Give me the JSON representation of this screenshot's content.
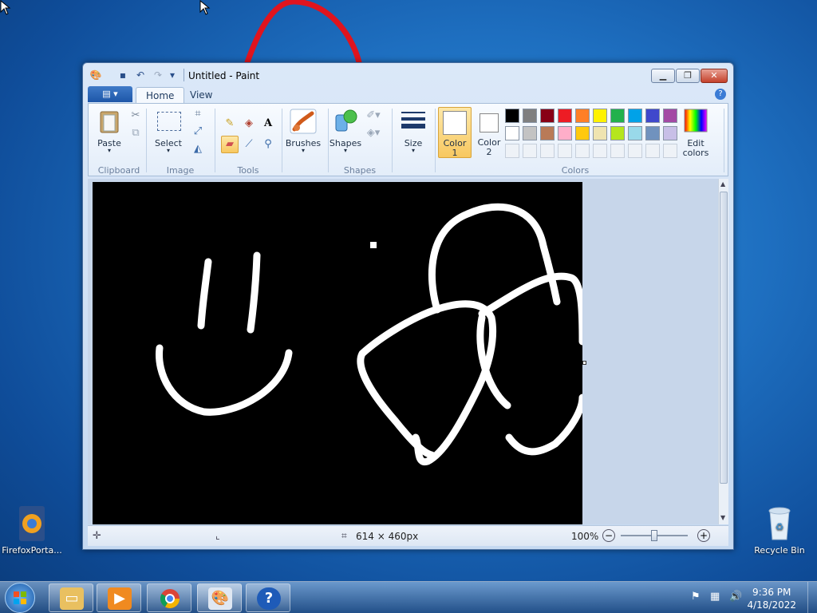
{
  "desktop": {
    "icons": [
      {
        "label": "FirefoxPorta..."
      },
      {
        "label": "Recycle Bin"
      }
    ]
  },
  "window": {
    "title": "Untitled - Paint",
    "tabs": {
      "home": "Home",
      "view": "View"
    },
    "ribbon": {
      "clipboard": {
        "group": "Clipboard",
        "paste": "Paste"
      },
      "image": {
        "group": "Image",
        "select": "Select"
      },
      "tools": {
        "group": "Tools"
      },
      "brushes": {
        "label": "Brushes"
      },
      "shapes": {
        "group": "Shapes",
        "label": "Shapes"
      },
      "size": {
        "label": "Size"
      },
      "color1": {
        "label": "Color",
        "num": "1",
        "color": "#ffffff"
      },
      "color2": {
        "label": "Color",
        "num": "2",
        "color": "#ffffff"
      },
      "colors": {
        "group": "Colors",
        "edit_label": "Edit",
        "edit_label2": "colors",
        "row1": [
          "#000000",
          "#7f7f7f",
          "#880015",
          "#ed1c24",
          "#ff7f27",
          "#fff200",
          "#22b14c",
          "#00a2e8",
          "#3f48cc",
          "#a349a4"
        ],
        "row2": [
          "#ffffff",
          "#c3c3c3",
          "#b97a57",
          "#ffaec9",
          "#ffc90e",
          "#efe4b0",
          "#b5e61d",
          "#99d9ea",
          "#7092be",
          "#c8bfe7"
        ]
      }
    },
    "status": {
      "dimensions": "614 × 460px",
      "zoom": "100%"
    }
  },
  "taskbar": {
    "time": "9:36 PM",
    "date": "4/18/2022",
    "buttons": [
      {
        "icon": "windows-explorer-icon"
      },
      {
        "icon": "media-player-icon"
      },
      {
        "icon": "chrome-icon"
      },
      {
        "icon": "paint-icon"
      },
      {
        "icon": "help-icon"
      }
    ]
  }
}
